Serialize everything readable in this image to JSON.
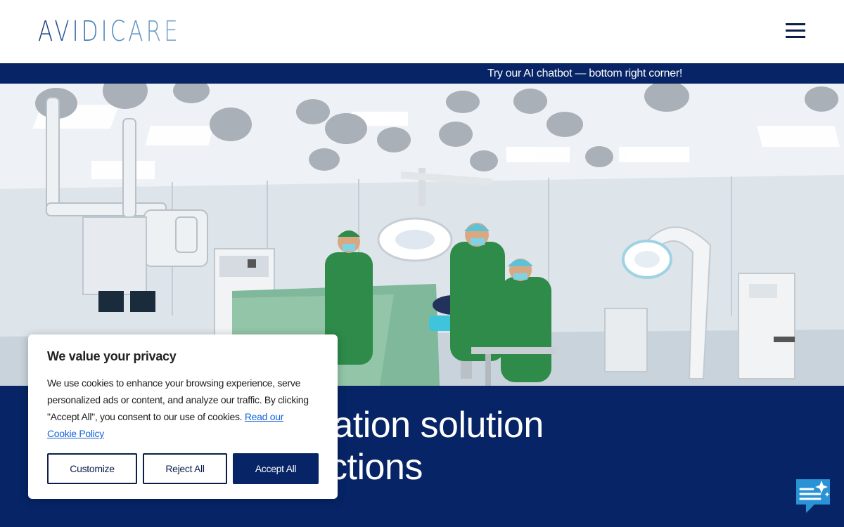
{
  "header": {
    "logo_text": "AVIDICARE",
    "menu_icon": "hamburger-menu-icon"
  },
  "announcement": {
    "text": "Try our AI chatbot — bottom right corner!"
  },
  "hero": {
    "image_subject": "operating-room-photo"
  },
  "main": {
    "headline_line1": "althcare ventilation solution",
    "headline_line2": "ards zero infections"
  },
  "cookie_banner": {
    "title": "We value your privacy",
    "body": "We use cookies to enhance your browsing experience, serve personalized ads or content, and analyze our traffic. By clicking \"Accept All\", you consent to our use of cookies.",
    "link_text": "Read our Cookie Policy",
    "customize_label": "Customize",
    "reject_label": "Reject All",
    "accept_label": "Accept All"
  },
  "chatbot": {
    "icon": "chat-sparkle-icon"
  },
  "colors": {
    "navy": "#062466",
    "link": "#1863dc",
    "chat_icon": "#2a93d5",
    "scrubs": "#2e8b4a"
  }
}
